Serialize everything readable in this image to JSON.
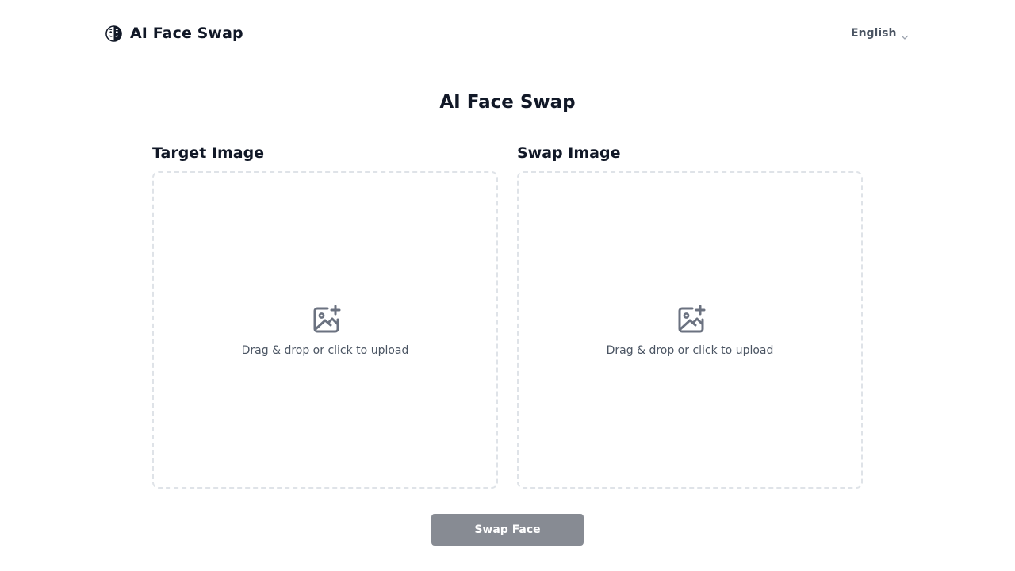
{
  "header": {
    "brand_name": "AI Face Swap",
    "logo_icon": "face-mask-icon",
    "language": {
      "selected": "English",
      "caret_icon": "chevron-down-icon"
    }
  },
  "main": {
    "title": "AI Face Swap",
    "panels": [
      {
        "label": "Target Image",
        "upload_hint": "Drag & drop or click to upload",
        "icon": "image-add-icon"
      },
      {
        "label": "Swap Image",
        "upload_hint": "Drag & drop or click to upload",
        "icon": "image-add-icon"
      }
    ],
    "submit_label": "Swap Face"
  },
  "colors": {
    "text": "#111827",
    "muted_text": "#4b5563",
    "dashed_border": "#dfe3e8",
    "button_bg": "#878b93",
    "icon": "#6b7280"
  }
}
